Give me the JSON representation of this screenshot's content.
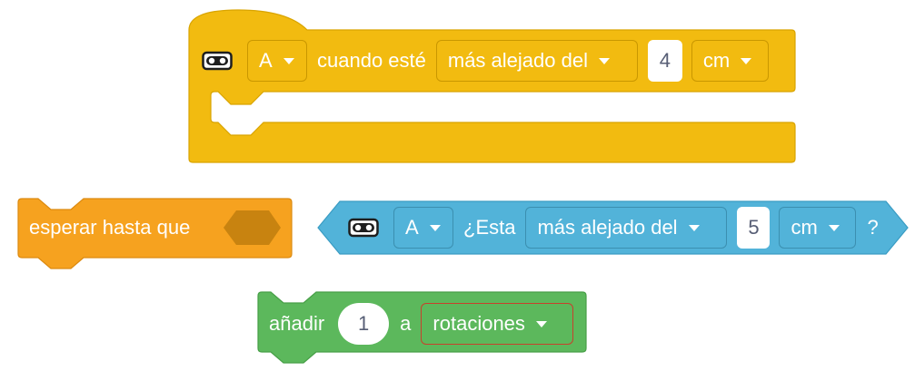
{
  "when_block": {
    "port": "A",
    "text": "cuando esté",
    "comparison": "más alejado del",
    "distance": "4",
    "unit": "cm",
    "color": "#f2bb10"
  },
  "wait_block": {
    "text": "esperar hasta que",
    "color": "#f6a21f"
  },
  "is_distance_block": {
    "port": "A",
    "text": "¿Esta",
    "comparison": "más alejado del",
    "distance": "5",
    "unit": "cm",
    "question": "?",
    "color": "#52b3d9"
  },
  "add_block": {
    "text": "añadir",
    "amount": "1",
    "connector": "a",
    "variable": "rotaciones",
    "color": "#5cb85c"
  },
  "icons": [
    "distance-sensor-icon",
    "chevron-down-icon"
  ]
}
